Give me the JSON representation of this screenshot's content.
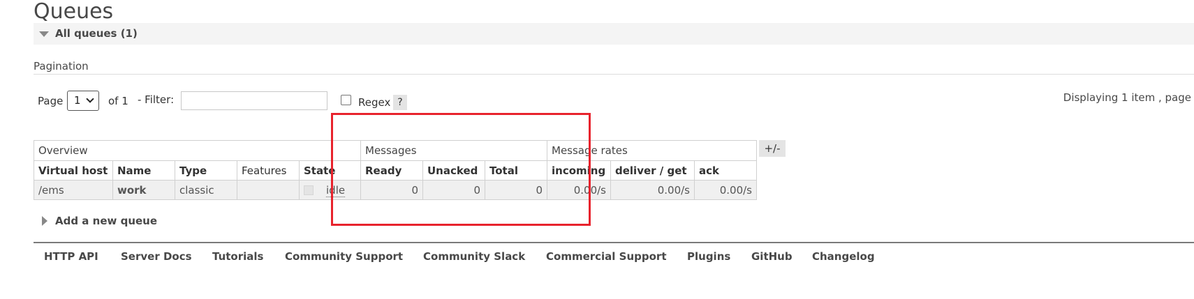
{
  "page": {
    "title": "Queues"
  },
  "section": {
    "title": "All queues (1)"
  },
  "pagination": {
    "label": "Pagination",
    "page_label": "Page",
    "page_value": "1",
    "of_label": "of 1",
    "filter_label": "- Filter:",
    "filter_value": "",
    "regex_label": "Regex",
    "help_label": "?",
    "displaying": "Displaying 1 item , page"
  },
  "table": {
    "groups": [
      "Overview",
      "Messages",
      "Message rates"
    ],
    "columns": [
      "Virtual host",
      "Name",
      "Type",
      "Features",
      "State",
      "Ready",
      "Unacked",
      "Total",
      "incoming",
      "deliver / get",
      "ack"
    ],
    "rows": [
      {
        "virtual_host": "/ems",
        "name": "work",
        "type": "classic",
        "features": "",
        "state": "idle",
        "ready": "0",
        "unacked": "0",
        "total": "0",
        "incoming": "0.00/s",
        "deliver_get": "0.00/s",
        "ack": "0.00/s"
      }
    ],
    "toggle_label": "+/-"
  },
  "add_queue": {
    "label": "Add a new queue"
  },
  "footer": {
    "links": [
      "HTTP API",
      "Server Docs",
      "Tutorials",
      "Community Support",
      "Community Slack",
      "Commercial Support",
      "Plugins",
      "GitHub",
      "Changelog"
    ]
  },
  "colors": {
    "annotation": "#e8232d",
    "section_bg": "#f4f4f4",
    "row_bg": "#f0f0f0"
  }
}
